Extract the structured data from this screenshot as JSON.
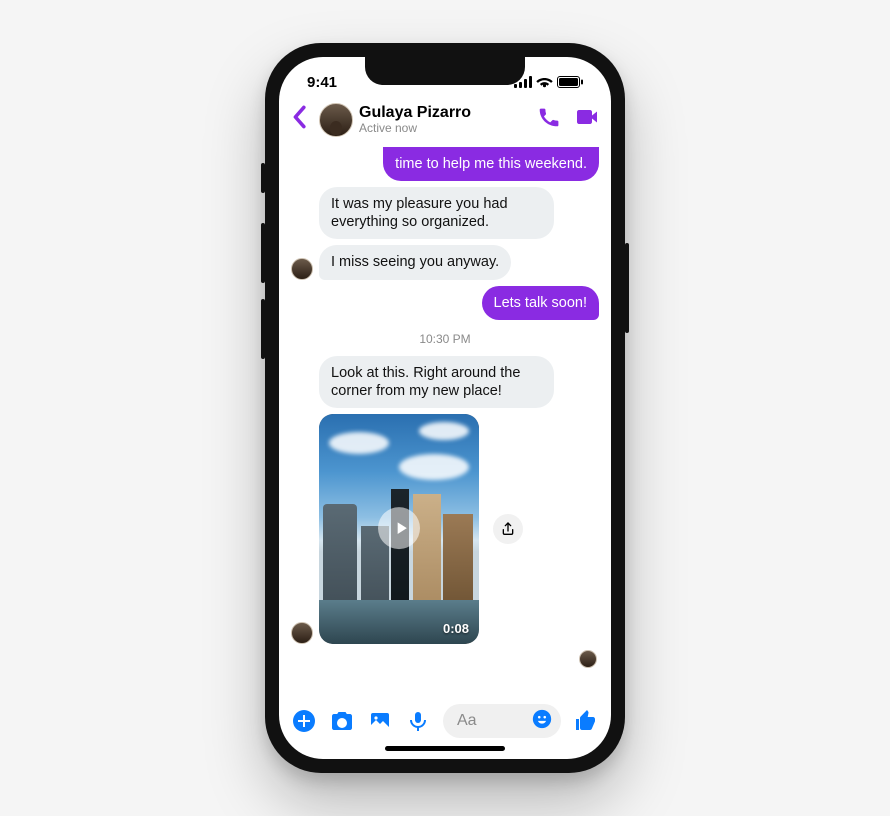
{
  "status_bar": {
    "time": "9:41"
  },
  "header": {
    "contact_name": "Gulaya Pizarro",
    "presence": "Active now"
  },
  "messages": {
    "m0": "time to help me this weekend.",
    "m1": "It was my pleasure you had everything so organized.",
    "m2": "I miss seeing you anyway.",
    "m3": "Lets talk soon!",
    "ts": "10:30 PM",
    "m4": "Look at this. Right around the corner from my new place!",
    "video_duration": "0:08"
  },
  "composer": {
    "placeholder": "Aa"
  }
}
